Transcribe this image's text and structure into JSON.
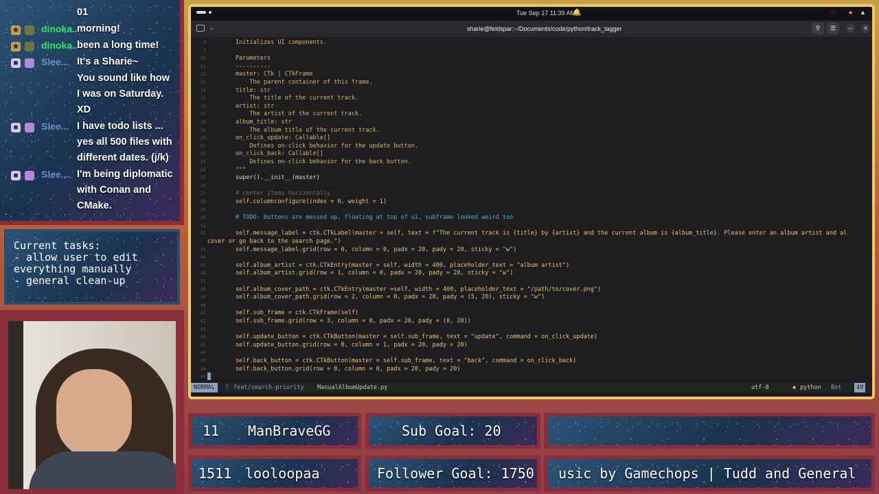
{
  "chat": {
    "messages": [
      {
        "username": "",
        "lines": [
          "01"
        ],
        "badge": "none",
        "color": ""
      },
      {
        "username": "dinoka...",
        "lines": [
          "morning!"
        ],
        "badge": "mod",
        "color": "green"
      },
      {
        "username": "dinoka...",
        "lines": [
          "been a long time!"
        ],
        "badge": "mod",
        "color": "green"
      },
      {
        "username": "Slee...",
        "lines": [
          "It's a Sharie~"
        ],
        "badge": "sub",
        "color": "blue"
      },
      {
        "username": "",
        "lines": [
          "You sound like how",
          "I was on Saturday.",
          "XD"
        ],
        "badge": "none",
        "color": ""
      },
      {
        "username": "Slee...",
        "lines": [
          "I have todo lists ...",
          "yes all 500 files with",
          "different dates. (j/k)"
        ],
        "badge": "sub",
        "color": "blue"
      },
      {
        "username": "Slee...",
        "lines": [
          "I'm being diplomatic",
          "with Conan and",
          "CMake."
        ],
        "badge": "sub",
        "color": "blue"
      }
    ]
  },
  "tasks": {
    "text": "Current tasks:\n- allow user to edit\neverything manually\n- general clean-up"
  },
  "terminal": {
    "topbar": {
      "datetime": "Tue Sep 17  11:39 AM"
    },
    "title": "sharie@feldspar:~/Documents/code/python/track_tagger",
    "code_lines": [
      {
        "n": "8",
        "text": "        Initializes UI components.",
        "color": "#d9b26b"
      },
      {
        "n": "9",
        "text": "",
        "color": "#d9b26b"
      },
      {
        "n": "10",
        "text": "        Parameters",
        "color": "#d9b26b"
      },
      {
        "n": "11",
        "text": "        ----------",
        "color": "#d9b26b"
      },
      {
        "n": "12",
        "text": "        master: CTk | CTkFrame",
        "color": "#d9b26b"
      },
      {
        "n": "13",
        "text": "            The parent container of this frame.",
        "color": "#d9b26b"
      },
      {
        "n": "14",
        "text": "        title: str",
        "color": "#d9b26b"
      },
      {
        "n": "15",
        "text": "            The title of the current track.",
        "color": "#d9b26b"
      },
      {
        "n": "16",
        "text": "        artist: str",
        "color": "#d9b26b"
      },
      {
        "n": "17",
        "text": "            The artist of the current track.",
        "color": "#d9b26b"
      },
      {
        "n": "18",
        "text": "        album_title: str",
        "color": "#d9b26b"
      },
      {
        "n": "19",
        "text": "            The album title of the current track.",
        "color": "#d9b26b"
      },
      {
        "n": "20",
        "text": "        on_click_update: Callable[]",
        "color": "#d9b26b"
      },
      {
        "n": "21",
        "text": "            Defines on-click behavior for the update button.",
        "color": "#d9b26b"
      },
      {
        "n": "22",
        "text": "        on_click_back: Callable[]",
        "color": "#d9b26b"
      },
      {
        "n": "23",
        "text": "            Defines on-click behavior for the back button.",
        "color": "#d9b26b"
      },
      {
        "n": "24",
        "text": "        \"\"\"",
        "color": "#d9b26b"
      },
      {
        "n": "25",
        "text": "        super().__init__(master)",
        "color": "#e0d7c0"
      },
      {
        "n": "26",
        "text": "",
        "color": "#e0d7c0"
      },
      {
        "n": "27",
        "text": "        # center items horizontally",
        "color": "#6b6b70"
      },
      {
        "n": "28",
        "text": "        self.columnconfigure(index = 0, weight = 1)",
        "color": "#e8c07a"
      },
      {
        "n": "29",
        "text": "",
        "color": "#e0d7c0"
      },
      {
        "n": "30",
        "text": "        # TODO: buttons are messed up, floating at top of ui, subframe looked weird too",
        "color": "#4fb0c6"
      },
      {
        "n": "31",
        "text": "",
        "color": "#e0d7c0"
      },
      {
        "n": "32",
        "text": "        self.message_label = ctk.CTkLabel(master = self, text = f\"The current track is {title} by {artist} and the current album is {album_title}. Please enter an album artist and al",
        "color": "#e8c07a"
      },
      {
        "n": "",
        "text": "cover or go back to the search page.\")",
        "color": "#e8c07a"
      },
      {
        "n": "33",
        "text": "        self.message_label.grid(row = 0, column = 0, padx = 20, pady = 20, sticky = \"w\")",
        "color": "#e8c07a"
      },
      {
        "n": "34",
        "text": "",
        "color": "#e0d7c0"
      },
      {
        "n": "35",
        "text": "        self.album_artist = ctk.CTkEntry(master = self, width = 400, placeholder_text = \"album artist\")",
        "color": "#e8c07a"
      },
      {
        "n": "36",
        "text": "        self.album_artist.grid(row = 1, column = 0, padx = 20, pady = 20, sticky = \"w\")",
        "color": "#e8c07a"
      },
      {
        "n": "37",
        "text": "",
        "color": "#e0d7c0"
      },
      {
        "n": "38",
        "text": "        self.album_cover_path = ctk.CTkEntry(master =self, width = 400, placeholder_text = \"/path/to/cover.png\")",
        "color": "#e8c07a"
      },
      {
        "n": "39",
        "text": "        self.album_cover_path.grid(row = 2, column = 0, padx = 20, pady = (5, 20), sticky = \"w\")",
        "color": "#e8c07a"
      },
      {
        "n": "40",
        "text": "",
        "color": "#e0d7c0"
      },
      {
        "n": "41",
        "text": "        self.sub_frame = ctk.CTkFrame(self)",
        "color": "#e8c07a"
      },
      {
        "n": "42",
        "text": "        self.sub_frame.grid(row = 3, column = 0, padx = 20, pady = (0, 20))",
        "color": "#e8c07a"
      },
      {
        "n": "43",
        "text": "",
        "color": "#e0d7c0"
      },
      {
        "n": "44",
        "text": "        self.update_button = ctk.CTkButton(master = self.sub_frame, text = \"update\", command = on_click_update)",
        "color": "#e8c07a"
      },
      {
        "n": "45",
        "text": "        self.update_button.grid(row = 0, column = 1, padx = 20, pady = 20)",
        "color": "#e8c07a"
      },
      {
        "n": "46",
        "text": "",
        "color": "#e0d7c0"
      },
      {
        "n": "47",
        "text": "        self.back_button = ctk.CTkButton(master = self.sub_frame, text = \"back\", command = on_click_back)",
        "color": "#e8c07a"
      },
      {
        "n": "48",
        "text": "        self.back_button.grid(row = 0, column = 0, padx = 20, pady = 20)",
        "color": "#e8c07a"
      },
      {
        "n": "49",
        "text": "",
        "color": "#e0d7c0"
      }
    ],
    "status": {
      "mode": "NORMAL",
      "branch": "feat/search-priority",
      "filename": "ManualAlbumUpdate.py",
      "encoding": "utf-8",
      "filetype": "python",
      "position": "Bot",
      "line": "49"
    }
  },
  "goals": {
    "recent_sub_count": "11",
    "recent_sub_name": "ManBraveGG",
    "sub_goal": "Sub Goal: 20",
    "recent_follow_count": "1511",
    "recent_follow_name": "looloopaa",
    "follower_goal": "Follower Goal: 1750",
    "ticker": "usic by Gamechops | Tudd and General"
  }
}
